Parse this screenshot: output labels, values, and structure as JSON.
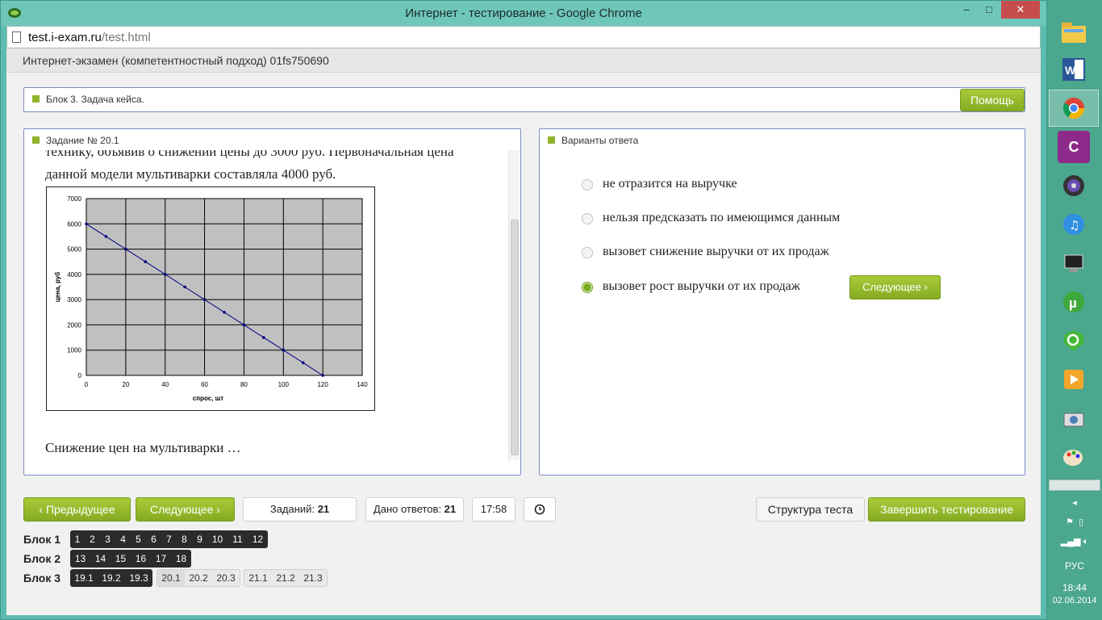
{
  "window": {
    "title": "Интернет - тестирование - Google Chrome",
    "minimize": "–",
    "maximize": "□",
    "close": "✕"
  },
  "address": {
    "host": "test.i-exam.ru",
    "path": "/test.html"
  },
  "exam": {
    "header": "Интернет-экзамен (компетентностный подход) 01fs750690"
  },
  "case_block": {
    "title": "Блок 3. Задача кейса.",
    "help": "Помощь"
  },
  "task": {
    "title": "Задание № 20.1",
    "text_line1": "технику, объявив о снижении цены до 3000 руб. Первоначальная цена",
    "text_line2": "данной модели мультиварки составляла 4000 руб.",
    "question": "Снижение цен на мультиварки …"
  },
  "chart_data": {
    "type": "line",
    "xlabel": "спрос, шт",
    "ylabel": "цена, руб",
    "xlim": [
      0,
      140
    ],
    "ylim": [
      0,
      7000
    ],
    "x_ticks": [
      0,
      20,
      40,
      60,
      80,
      100,
      120,
      140
    ],
    "y_ticks": [
      0,
      1000,
      2000,
      3000,
      4000,
      5000,
      6000,
      7000
    ],
    "grid": true,
    "series": [
      {
        "x": [
          0,
          10,
          20,
          30,
          40,
          50,
          60,
          70,
          80,
          90,
          100,
          110,
          120
        ],
        "y": [
          6000,
          5500,
          5000,
          4500,
          4000,
          3500,
          3000,
          2500,
          2000,
          1500,
          1000,
          500,
          0
        ]
      }
    ],
    "colors": {
      "plot_bg": "#c0c0c0",
      "line": "#000080"
    }
  },
  "answers": {
    "title": "Варианты ответа",
    "options": [
      {
        "label": "не отразится на выручке",
        "selected": false
      },
      {
        "label": "нельзя предсказать по имеющимся данным",
        "selected": false
      },
      {
        "label": "вызовет снижение выручки от их продаж",
        "selected": false
      },
      {
        "label": "вызовет рост выручки от их продаж",
        "selected": true
      }
    ],
    "next": "Следующее"
  },
  "toolbar": {
    "prev": "Предыдущее",
    "next": "Следующее",
    "tasks_label": "Заданий:",
    "tasks_count": "21",
    "answered_label": "Дано ответов:",
    "answered_count": "21",
    "timer": "17:58",
    "structure": "Структура теста",
    "finish": "Завершить тестирование"
  },
  "blocks": {
    "b1": {
      "label": "Блок 1",
      "items": [
        "1",
        "2",
        "3",
        "4",
        "5",
        "6",
        "7",
        "8",
        "9",
        "10",
        "11",
        "12"
      ]
    },
    "b2": {
      "label": "Блок 2",
      "items": [
        "13",
        "14",
        "15",
        "16",
        "17",
        "18"
      ]
    },
    "b3": {
      "label": "Блок 3",
      "done": [
        "19.1",
        "19.2",
        "19.3"
      ],
      "group20": [
        "20.1",
        "20.2",
        "20.3"
      ],
      "group21": [
        "21.1",
        "21.2",
        "21.3"
      ]
    }
  },
  "taskbar": {
    "icons": [
      "file-explorer-icon",
      "word-icon",
      "chrome-icon",
      "app-c-icon",
      "media-player-icon",
      "itunes-icon",
      "computer-icon",
      "utorrent-icon",
      "search-tool-icon",
      "video-icon",
      "camera-icon",
      "paint-icon"
    ],
    "lang": "РУС",
    "time": "18:44",
    "date": "02.06.2014"
  },
  "colors": {
    "accent_green": "#8fb32b",
    "panel_border": "#7b8cc4",
    "taskbar": "#4ba78d"
  }
}
